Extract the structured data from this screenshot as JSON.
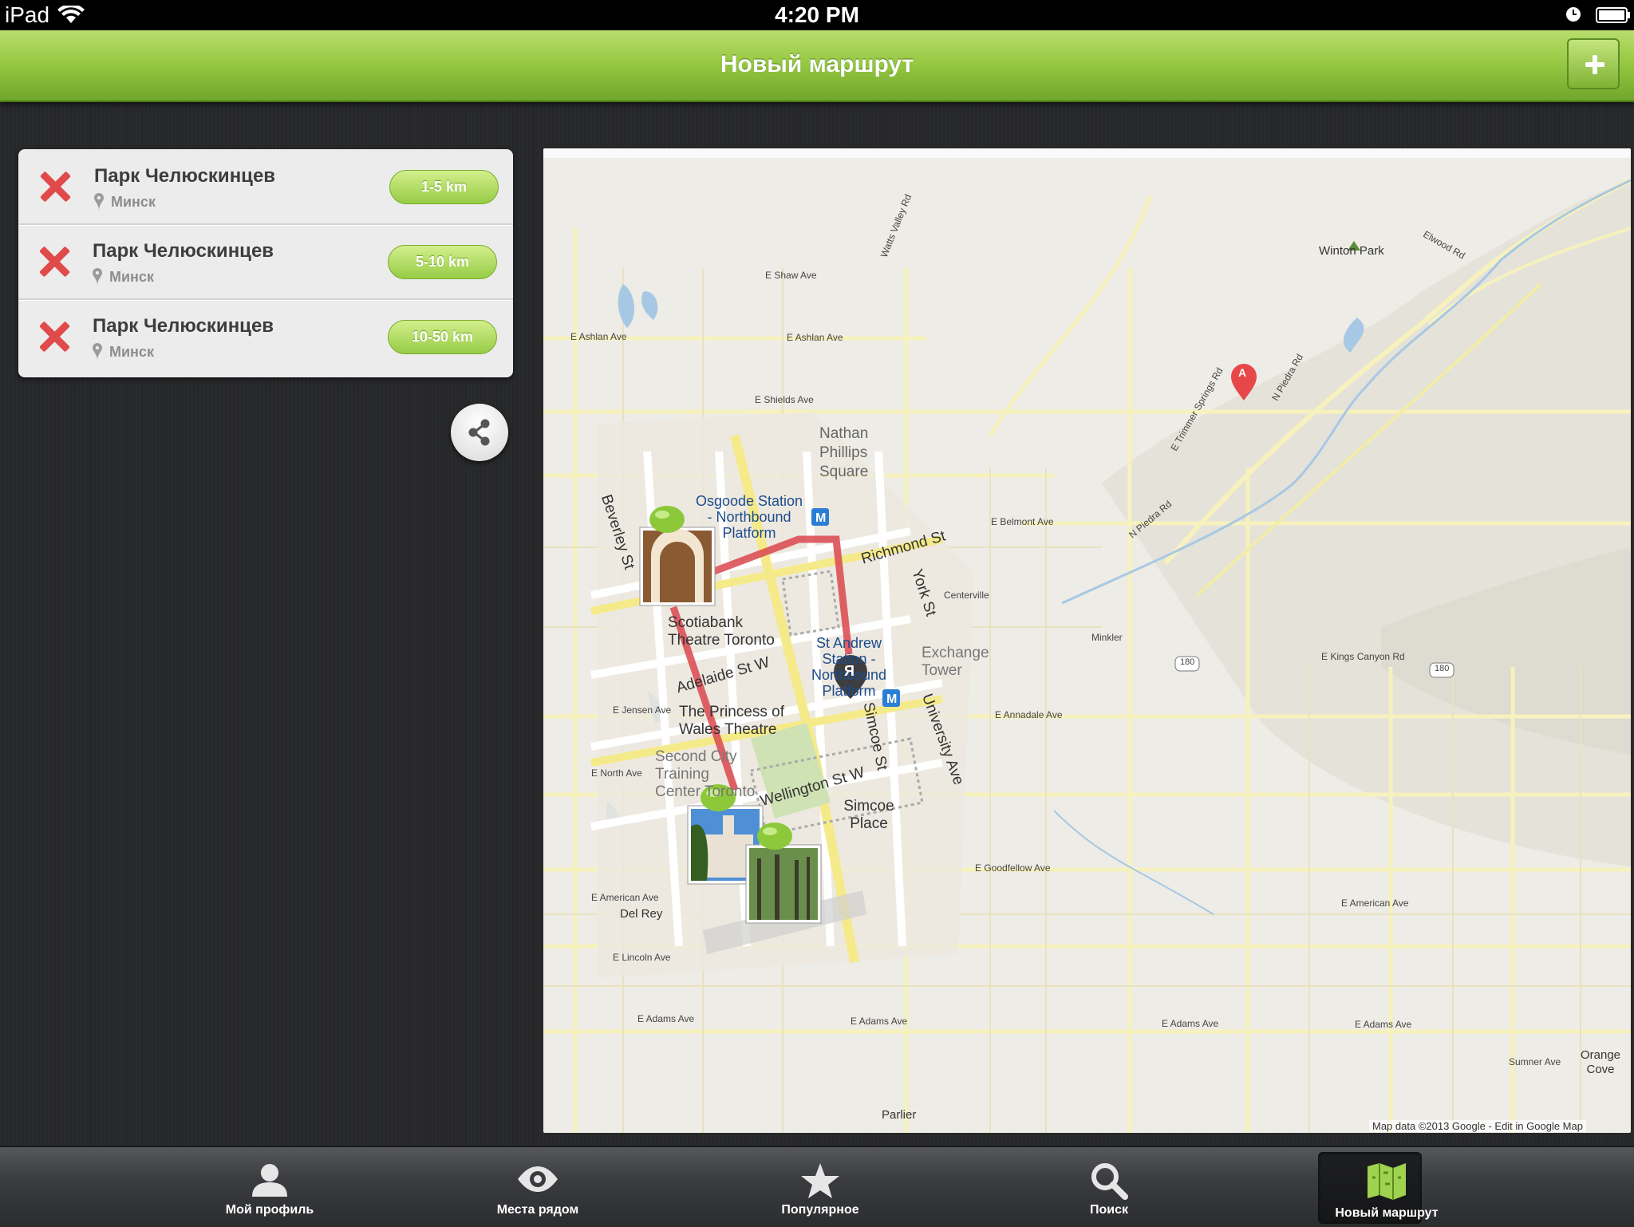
{
  "status_bar": {
    "device": "iPad",
    "time": "4:20 PM"
  },
  "nav": {
    "title": "Новый маршрут"
  },
  "route_items": [
    {
      "name": "Парк Челюскинцев",
      "city": "Минск",
      "distance": "1-5 km"
    },
    {
      "name": "Парк Челюскинцев",
      "city": "Минск",
      "distance": "5-10 km"
    },
    {
      "name": "Парк Челюскинцев",
      "city": "Минск",
      "distance": "10-50 km"
    }
  ],
  "map": {
    "labels": {
      "winton_park": "Winton Park",
      "osgoode": "Osgoode Station - Northbound Platform",
      "nathan": "Nathan Phillips Square",
      "richmond": "Richmond St",
      "beverley": "Beverley St",
      "scotiabank": "Scotiabank Theatre Toronto",
      "standrew": "St Andrew Station - Northbound Platform",
      "adelaide": "Adelaide St W",
      "princess": "The Princess of Wales Theatre",
      "wellington": "Wellington St W",
      "simcoe_place": "Simcoe Place",
      "simcoe_st": "Simcoe St",
      "york": "York St",
      "university": "University Ave",
      "second_city": "Second City Training Center Toronto",
      "centerville": "Centerville",
      "minkler": "Minkler",
      "exchange": "Exchange Tower",
      "shaw": "E Shaw Ave",
      "ashlan1": "E Ashlan Ave",
      "ashlan2": "E Ashlan Ave",
      "shields": "E Shields Ave",
      "belmont": "E Belmont Ave",
      "kings_canyon": "E Kings Canyon Rd",
      "annadale": "E Annadale Ave",
      "goodfellow": "E Goodfellow Ave",
      "american1": "E American Ave",
      "american2": "E American Ave",
      "adams1": "E Adams Ave",
      "adams2": "E Adams Ave",
      "adams3": "E Adams Ave",
      "adams4": "E Adams Ave",
      "lincoln": "E Lincoln Ave",
      "jensen": "E Jensen Ave",
      "north": "E North Ave",
      "del_rey": "Del Rey",
      "parlier": "Parlier",
      "sumner": "Sumner Ave",
      "orange_cove": "Orange Cove",
      "trimmer": "E Trimmer Springs Rd",
      "piedra1": "N Piedra Rd",
      "piedra2": "N Piedra Rd",
      "elwood": "Elwood Rd",
      "watts": "Watts Valley Rd",
      "hwy180a": "180",
      "hwy180b": "180",
      "marker_a": "A",
      "marker_ya": "Я"
    },
    "credit": "Map data ©2013 Google - Edit in Google Map"
  },
  "tabs": [
    {
      "label": "Мой профиль",
      "icon": "person-icon"
    },
    {
      "label": "Места рядом",
      "icon": "eye-icon"
    },
    {
      "label": "Популярное",
      "icon": "star-icon"
    },
    {
      "label": "Поиск",
      "icon": "search-icon"
    },
    {
      "label": "Новый маршрут",
      "icon": "map-icon",
      "active": true
    }
  ],
  "colors": {
    "accent_green": "#8fc33e",
    "delete_red": "#e04a4a",
    "route_red": "#d9474e"
  }
}
